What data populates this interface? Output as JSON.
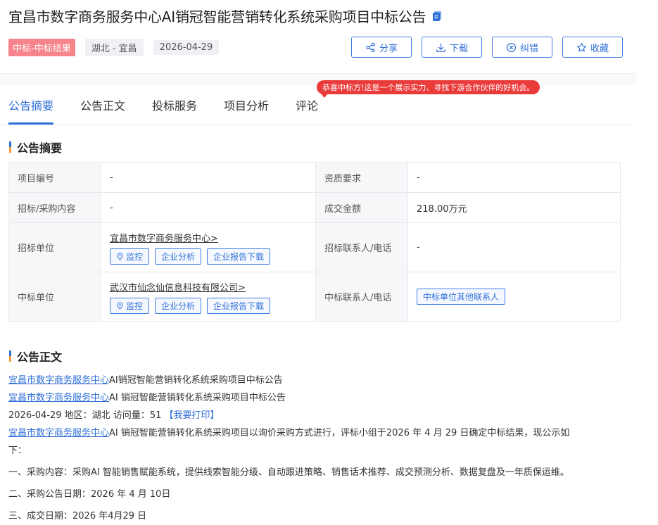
{
  "header": {
    "title": "宜昌市数字商务服务中心AI销冠智能营销转化系统采购项目中标公告",
    "status_badge": "中标-中标结果",
    "region": "湖北 - 宜昌",
    "date": "2026-04-29"
  },
  "actions": {
    "share": "分享",
    "download": "下载",
    "correct": "纠错",
    "favorite": "收藏"
  },
  "tabs": {
    "summary": "公告摘要",
    "content": "公告正文",
    "bid_service": "投标服务",
    "analysis": "项目分析",
    "comments": "评论",
    "tooltip": "恭喜中标方!这是一个展示实力、寻找下游合作伙伴的好机会。"
  },
  "summary": {
    "heading": "公告摘要",
    "rows": {
      "project_no_label": "项目编号",
      "project_no_value": "-",
      "qualification_label": "资质要求",
      "qualification_value": "-",
      "content_label": "招标/采购内容",
      "content_value": "-",
      "amount_label": "成交金额",
      "amount_value": "218.00万元",
      "buyer_label": "招标单位",
      "buyer_name": "宜昌市数字商务服务中心>",
      "buyer_contact_label": "招标联系人/电话",
      "buyer_contact_value": "-",
      "winner_label": "中标单位",
      "winner_name": "武汉市仙念仙信息科技有限公司>",
      "winner_contact_label": "中标联系人/电话",
      "winner_contact_button": "中标单位其他联系人"
    },
    "buttons": {
      "monitor": "监控",
      "analysis": "企业分析",
      "report": "企业报告下载"
    }
  },
  "content": {
    "heading": "公告正文",
    "buyer_link": "宜昌市数字商务服务中心",
    "line1_suffix": "AI销冠智能营销转化系统采购项目中标公告",
    "line2_suffix": "AI 销冠智能营销转化系统采购项目中标公告",
    "meta_line": "2026-04-29 地区：湖北 访问量：51",
    "print": "【我要打印】",
    "para_suffix": "AI 销冠智能营销转化系统采购项目以询价采购方式进行，评标小组于2026 年 4 月 29 日确定中标结果，现公示如",
    "para_cont": "下：",
    "item1": "一、采购内容：采购AI 智能销售赋能系统，提供线索智能分级、自动跟进策略、销售话术推荐、成交预测分析、数据复盘及一年质保运维。",
    "item2": "二、采购公告日期：2026 年 4 月 10日",
    "item3": "三、成交日期：2026 年4月29 日"
  }
}
